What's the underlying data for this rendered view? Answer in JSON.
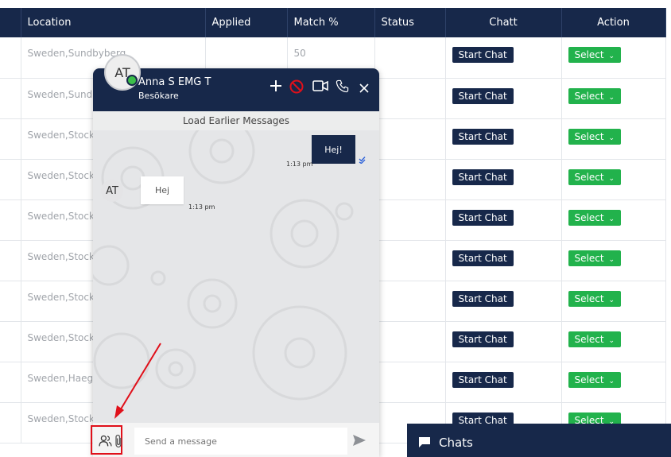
{
  "table": {
    "columns": [
      {
        "key": "prev",
        "label": ""
      },
      {
        "key": "location",
        "label": "Location"
      },
      {
        "key": "applied",
        "label": "Applied"
      },
      {
        "key": "match",
        "label": "Match %"
      },
      {
        "key": "status",
        "label": "Status"
      },
      {
        "key": "chatt",
        "label": "Chatt"
      },
      {
        "key": "action",
        "label": "Action"
      }
    ],
    "rows": [
      {
        "location": "Sweden,Sundbyberg",
        "match": "50"
      },
      {
        "location": "Sweden,Sundbyberg",
        "match": ""
      },
      {
        "location": "Sweden,Stockholm",
        "match": ""
      },
      {
        "location": "Sweden,Stockholm",
        "match": ""
      },
      {
        "location": "Sweden,Stockholm",
        "match": ""
      },
      {
        "location": "Sweden,Stockholm",
        "match": ""
      },
      {
        "location": "Sweden,Stockholm",
        "match": ""
      },
      {
        "location": "Sweden,Stockholm",
        "match": ""
      },
      {
        "location": "Sweden,Haegersten",
        "match": ""
      },
      {
        "location": "Sweden,Stockholm",
        "match": ""
      }
    ],
    "start_chat_label": "Start Chat",
    "select_label": "Select"
  },
  "chat": {
    "avatar_initials": "AT",
    "name": "Anna S EMG T",
    "subtitle": "Besökare",
    "load_earlier": "Load Earlier Messages",
    "outgoing": {
      "text": "Hej!",
      "time": "1:13 pm"
    },
    "incoming": {
      "text": "Hej",
      "time": "1:13 pm",
      "avatar": "AT"
    },
    "input_placeholder": "Send a message"
  },
  "chats_bar": {
    "label": "Chats"
  },
  "colors": {
    "navy": "#17284a",
    "green": "#22b24c",
    "highlight": "#e0101a",
    "online": "#3cbf4a"
  }
}
